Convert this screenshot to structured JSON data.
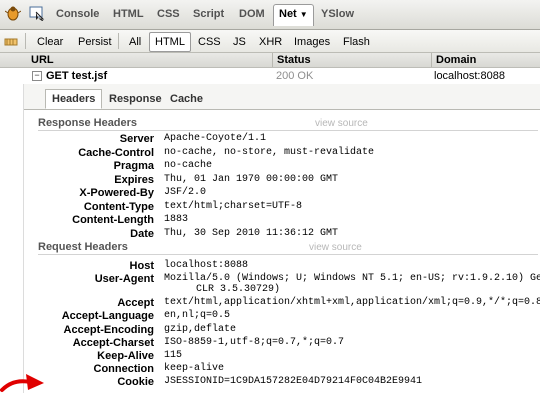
{
  "tabbar": {
    "tabs": [
      "Console",
      "HTML",
      "CSS",
      "Script",
      "DOM",
      "Net",
      "YSlow"
    ],
    "active": "Net",
    "active_chevron": "▼"
  },
  "toolbar": {
    "clear": "Clear",
    "persist": "Persist",
    "filters": [
      "All",
      "HTML",
      "CSS",
      "JS",
      "XHR",
      "Images",
      "Flash"
    ],
    "selected_filter": "HTML"
  },
  "columns": {
    "url": "URL",
    "status": "Status",
    "domain": "Domain"
  },
  "request": {
    "toggle": "−",
    "url": "GET test.jsf",
    "status": "200 OK",
    "domain": "localhost:8088"
  },
  "detail": {
    "tabs": [
      "Headers",
      "Response",
      "Cache"
    ],
    "active_tab": "Headers",
    "view_source": "view source",
    "response_title": "Response Headers",
    "response_headers": [
      {
        "name": "Server",
        "value": "Apache-Coyote/1.1"
      },
      {
        "name": "Cache-Control",
        "value": "no-cache, no-store, must-revalidate"
      },
      {
        "name": "Pragma",
        "value": "no-cache"
      },
      {
        "name": "Expires",
        "value": "Thu, 01 Jan 1970 00:00:00 GMT"
      },
      {
        "name": "X-Powered-By",
        "value": "JSF/2.0"
      },
      {
        "name": "Content-Type",
        "value": "text/html;charset=UTF-8"
      },
      {
        "name": "Content-Length",
        "value": "1883"
      },
      {
        "name": "Date",
        "value": "Thu, 30 Sep 2010 11:36:12 GMT"
      }
    ],
    "request_title": "Request Headers",
    "request_headers": [
      {
        "name": "Host",
        "value": "localhost:8088"
      },
      {
        "name": "User-Agent",
        "value": "Mozilla/5.0 (Windows; U; Windows NT 5.1; en-US; rv:1.9.2.10) Gec",
        "value2": "CLR 3.5.30729)"
      },
      {
        "name": "Accept",
        "value": "text/html,application/xhtml+xml,application/xml;q=0.9,*/*;q=0.8"
      },
      {
        "name": "Accept-Language",
        "value": "en,nl;q=0.5"
      },
      {
        "name": "Accept-Encoding",
        "value": "gzip,deflate"
      },
      {
        "name": "Accept-Charset",
        "value": "ISO-8859-1,utf-8;q=0.7,*;q=0.7"
      },
      {
        "name": "Keep-Alive",
        "value": "115"
      },
      {
        "name": "Connection",
        "value": "keep-alive"
      },
      {
        "name": "Cookie",
        "value": "JSESSIONID=1C9DA157282E04D79214F0C04B2E9941"
      }
    ]
  },
  "colors": {
    "arrow": "#e00000",
    "view_source": "#b7b7b7"
  },
  "icons": [
    "firebug-bug-icon",
    "inspect-icon",
    "clear-log-icon",
    "red-arrow-annotation"
  ]
}
